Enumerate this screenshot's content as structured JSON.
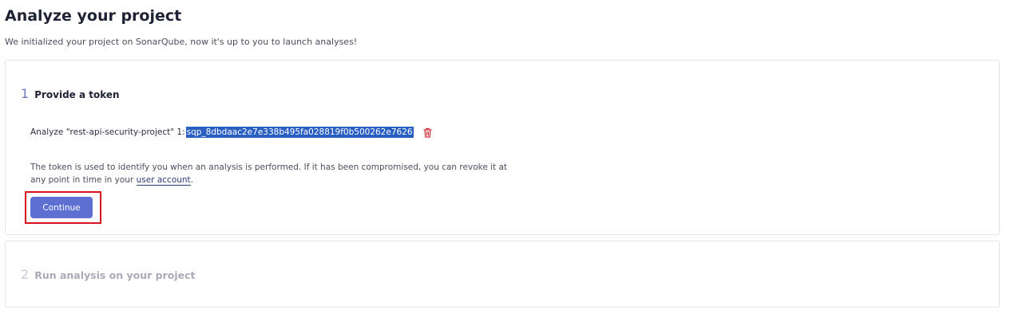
{
  "page": {
    "title": "Analyze your project",
    "subtitle": "We initialized your project on SonarQube, now it's up to you to launch analyses!"
  },
  "step1": {
    "number": "1",
    "title": "Provide a token",
    "token_label": "Analyze \"rest-api-security-project\" 1:",
    "token_value": "sqp_8dbdaac2e7e338b495fa028819f0b500262e7626",
    "delete_icon": "trash-icon",
    "help_text_before": "The token is used to identify you when an analysis is performed. If it has been compromised, you can revoke it at any point in time in your ",
    "help_link": "user account",
    "help_text_after": ".",
    "continue_label": "Continue"
  },
  "step2": {
    "number": "2",
    "title": "Run analysis on your project"
  },
  "colors": {
    "accent": "#5d6fd0",
    "token_highlight": "#2a5fc2",
    "delete": "#d02f3a",
    "highlight_border": "#d8121e"
  }
}
